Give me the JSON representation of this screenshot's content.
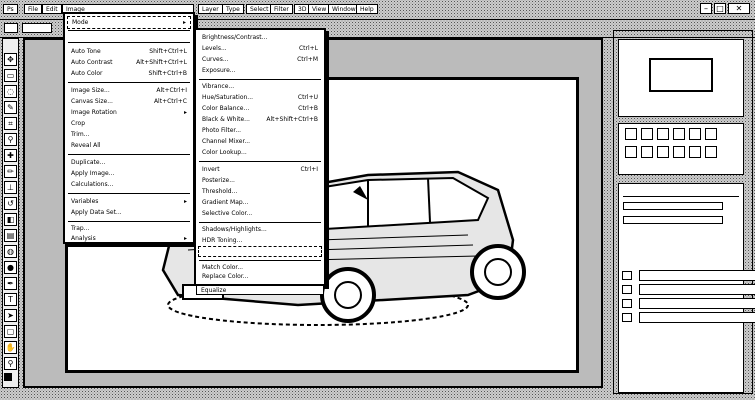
{
  "menubar": {
    "items": [
      "Ps",
      "File",
      "Edit",
      "Image",
      "Layer",
      "Type",
      "Select",
      "Filter",
      "3D",
      "View",
      "Window",
      "Help"
    ]
  },
  "image_menu": {
    "mode_label": "Mode",
    "items": [
      {
        "label": "Auto Tone",
        "shortcut": "Shift+Ctrl+L"
      },
      {
        "label": "Auto Contrast",
        "shortcut": "Alt+Shift+Ctrl+L"
      },
      {
        "label": "Auto Color",
        "shortcut": "Shift+Ctrl+B"
      },
      {
        "label": "Image Size...",
        "shortcut": "Alt+Ctrl+I"
      },
      {
        "label": "Canvas Size...",
        "shortcut": "Alt+Ctrl+C"
      },
      {
        "label": "Image Rotation",
        "shortcut": ""
      },
      {
        "label": "Crop",
        "shortcut": ""
      },
      {
        "label": "Trim...",
        "shortcut": ""
      },
      {
        "label": "Reveal All",
        "shortcut": ""
      },
      {
        "label": "Duplicate...",
        "shortcut": ""
      },
      {
        "label": "Apply Image...",
        "shortcut": ""
      },
      {
        "label": "Calculations...",
        "shortcut": ""
      },
      {
        "label": "Variables",
        "shortcut": ""
      },
      {
        "label": "Apply Data Set...",
        "shortcut": ""
      },
      {
        "label": "Trap...",
        "shortcut": ""
      },
      {
        "label": "Analysis",
        "shortcut": ""
      }
    ]
  },
  "adjust_menu": {
    "items": [
      {
        "label": "Brightness/Contrast...",
        "shortcut": ""
      },
      {
        "label": "Levels...",
        "shortcut": "Ctrl+L"
      },
      {
        "label": "Curves...",
        "shortcut": "Ctrl+M"
      },
      {
        "label": "Exposure...",
        "shortcut": ""
      },
      {
        "label": "Vibrance...",
        "shortcut": ""
      },
      {
        "label": "Hue/Saturation...",
        "shortcut": "Ctrl+U"
      },
      {
        "label": "Color Balance...",
        "shortcut": "Ctrl+B"
      },
      {
        "label": "Black & White...",
        "shortcut": "Alt+Shift+Ctrl+B"
      },
      {
        "label": "Photo Filter...",
        "shortcut": ""
      },
      {
        "label": "Channel Mixer...",
        "shortcut": ""
      },
      {
        "label": "Color Lookup...",
        "shortcut": ""
      },
      {
        "label": "Invert",
        "shortcut": "Ctrl+I"
      },
      {
        "label": "Posterize...",
        "shortcut": ""
      },
      {
        "label": "Threshold...",
        "shortcut": ""
      },
      {
        "label": "Gradient Map...",
        "shortcut": ""
      },
      {
        "label": "Selective Color...",
        "shortcut": ""
      },
      {
        "label": "Shadows/Highlights...",
        "shortcut": ""
      },
      {
        "label": "HDR Toning...",
        "shortcut": ""
      },
      {
        "label": "Match Color...",
        "shortcut": ""
      },
      {
        "label": "Replace Color...",
        "shortcut": ""
      },
      {
        "label": "Equalize",
        "shortcut": ""
      }
    ]
  }
}
